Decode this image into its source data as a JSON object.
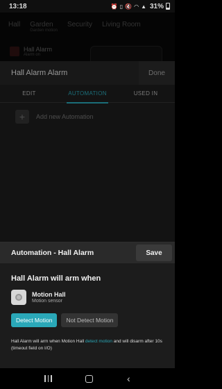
{
  "status_bar": {
    "time": "13:18",
    "battery": "31%",
    "icons": [
      "alarm-icon",
      "vibrate-icon",
      "mute-icon",
      "wifi-icon",
      "signal-icon",
      "battery-icon"
    ]
  },
  "background_app": {
    "tabs": [
      {
        "label": "Hall",
        "sub": ""
      },
      {
        "label": "Garden",
        "sub": "Garden motion"
      },
      {
        "label": "Security",
        "sub": ""
      },
      {
        "label": "Living Room",
        "sub": ""
      }
    ],
    "card_title": "Hall Alarm",
    "card_sub": "Alarm on"
  },
  "alarm_panel": {
    "title": "Hall Alarm Alarm",
    "done_label": "Done",
    "tabs": [
      {
        "label": "EDIT",
        "active": false
      },
      {
        "label": "AUTOMATION",
        "active": true
      },
      {
        "label": "USED IN",
        "active": false
      }
    ],
    "add_label": "Add new Automation"
  },
  "sheet": {
    "title": "Automation - Hall Alarm",
    "save_label": "Save",
    "arm_heading": "Hall Alarm will arm when",
    "sensor_name": "Motion Hall",
    "sensor_type": "Motion sensor",
    "choice_on": "Detect Motion",
    "choice_off": "Not Detect Motion",
    "desc_pre": "Hall Alarm will arm when Motion Hall ",
    "desc_hl": "detect motion",
    "desc_post": " and will disarm after 10s (timeout field on I/O)"
  },
  "colors": {
    "accent": "#2aa8b8",
    "sheet_bg": "#1c1c1c",
    "panel_bg": "#1e1e1e"
  }
}
